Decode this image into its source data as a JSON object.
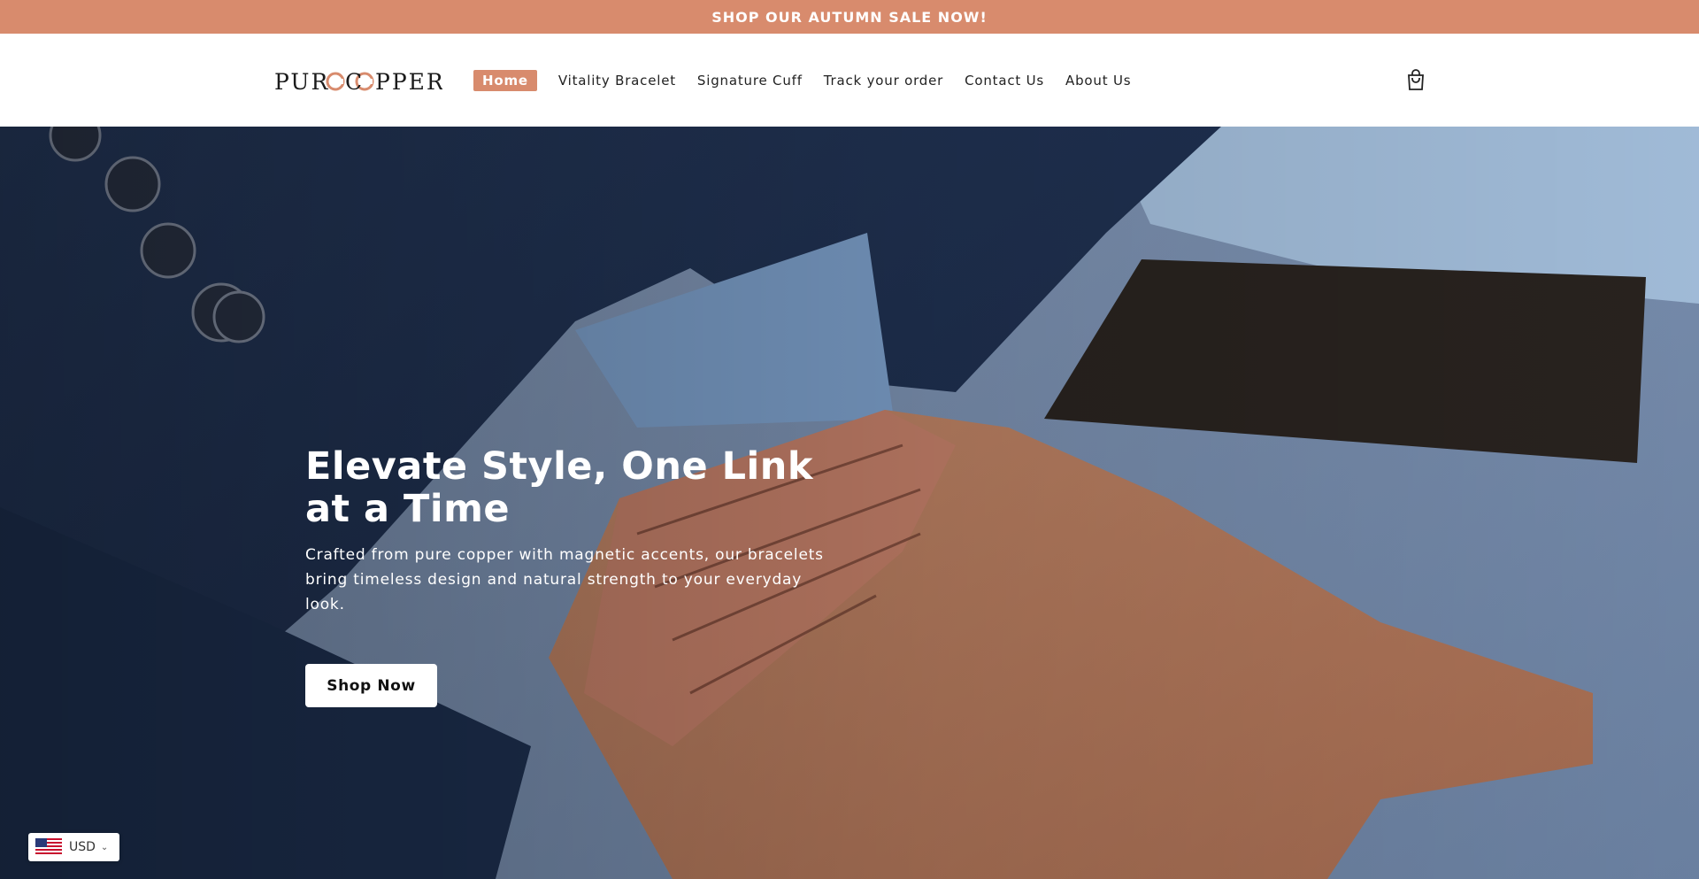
{
  "announcement": {
    "text": "SHOP OUR AUTUMN SALE NOW!"
  },
  "brand": {
    "logo_text": "PURCOPPER",
    "accent_color": "#d88b6d"
  },
  "nav": {
    "items": [
      {
        "label": "Home",
        "active": true
      },
      {
        "label": "Vitality Bracelet",
        "active": false
      },
      {
        "label": "Signature Cuff",
        "active": false
      },
      {
        "label": "Track your order",
        "active": false
      },
      {
        "label": "Contact Us",
        "active": false
      },
      {
        "label": "About Us",
        "active": false
      }
    ],
    "cart_icon": "shopping-bag-icon"
  },
  "hero": {
    "title": "Elevate Style, One Link at a Time",
    "subtitle": "Crafted from pure copper with magnetic accents, our bracelets bring timeless design and natural strength to your everyday look.",
    "cta_label": "Shop Now"
  },
  "currency": {
    "code": "USD",
    "flag_icon": "us-flag-icon"
  }
}
